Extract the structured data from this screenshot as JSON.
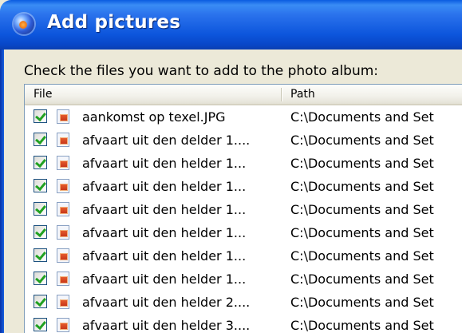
{
  "window": {
    "title": "Add pictures"
  },
  "instruction": "Check the files you want to add to the photo album:",
  "columns": {
    "file": "File",
    "path": "Path"
  },
  "rows": [
    {
      "checked": true,
      "name": "aankomst op texel.JPG",
      "path": "C:\\Documents and Set"
    },
    {
      "checked": true,
      "name": "afvaart uit den delder 1....",
      "path": "C:\\Documents and Set"
    },
    {
      "checked": true,
      "name": "afvaart uit den helder 1...",
      "path": "C:\\Documents and Set"
    },
    {
      "checked": true,
      "name": "afvaart uit den helder 1...",
      "path": "C:\\Documents and Set"
    },
    {
      "checked": true,
      "name": "afvaart uit den helder 1...",
      "path": "C:\\Documents and Set"
    },
    {
      "checked": true,
      "name": "afvaart uit den helder 1...",
      "path": "C:\\Documents and Set"
    },
    {
      "checked": true,
      "name": "afvaart uit den helder 1...",
      "path": "C:\\Documents and Set"
    },
    {
      "checked": true,
      "name": "afvaart uit den helder 1...",
      "path": "C:\\Documents and Set"
    },
    {
      "checked": true,
      "name": "afvaart uit den helder 2....",
      "path": "C:\\Documents and Set"
    },
    {
      "checked": true,
      "name": "afvaart uit den helder 3....",
      "path": "C:\\Documents and Set"
    }
  ],
  "icons": {
    "window": "photo-album-icon",
    "row": "picture-file-icon",
    "check": "checkbox-checked-icon"
  },
  "colors": {
    "titlebar": "#0c55dc",
    "check_mark": "#21a121",
    "window_bg": "#ece9d8"
  }
}
